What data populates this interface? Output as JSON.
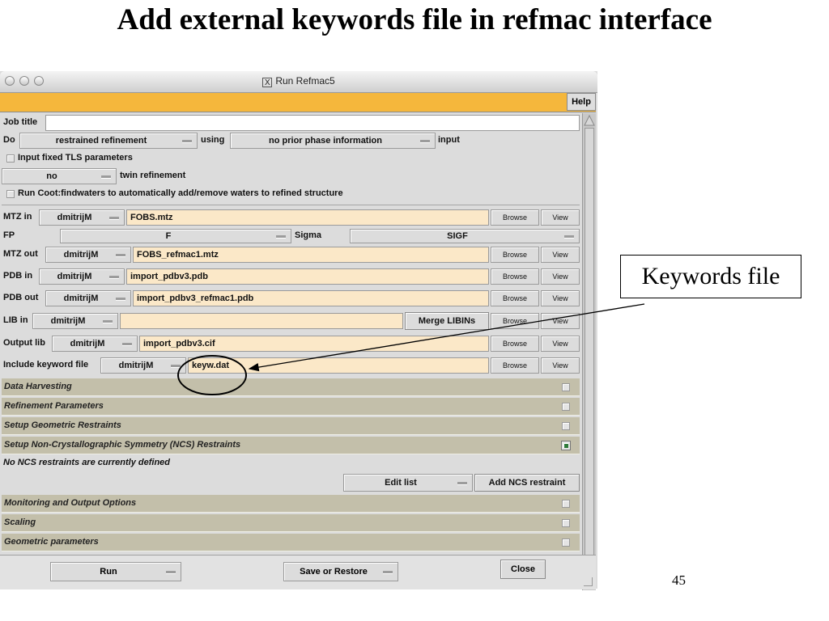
{
  "slide": {
    "title": "Add external keywords file in refmac interface",
    "page_number": "45"
  },
  "window": {
    "title": "Run Refmac5",
    "help_label": "Help"
  },
  "job": {
    "label": "Job title",
    "value": ""
  },
  "do_row": {
    "do_label": "Do",
    "mode": "restrained refinement",
    "using_label": "using",
    "phase": "no prior phase information",
    "input_label": "input"
  },
  "tls": {
    "label": "Input fixed TLS parameters",
    "checked": false
  },
  "twin": {
    "value": "no",
    "label": "twin refinement"
  },
  "coot": {
    "label": "Run Coot:findwaters to automatically add/remove waters to refined structure",
    "checked": false
  },
  "files": {
    "browse_label": "Browse",
    "view_label": "View",
    "mtz_in": {
      "label": "MTZ in",
      "project": "dmitrijM",
      "value": "FOBS.mtz"
    },
    "fp": {
      "label": "FP",
      "value": "F",
      "sigma_label": "Sigma",
      "sigma_value": "SIGF"
    },
    "mtz_out": {
      "label": "MTZ out",
      "project": "dmitrijM",
      "value": "FOBS_refmac1.mtz"
    },
    "pdb_in": {
      "label": "PDB in",
      "project": "dmitrijM",
      "value": "import_pdbv3.pdb"
    },
    "pdb_out": {
      "label": "PDB out",
      "project": "dmitrijM",
      "value": "import_pdbv3_refmac1.pdb"
    },
    "lib_in": {
      "label": "LIB in",
      "project": "dmitrijM",
      "value": "",
      "merge_label": "Merge LIBINs"
    },
    "output_lib": {
      "label": "Output lib",
      "project": "dmitrijM",
      "value": "import_pdbv3.cif"
    },
    "keyword_file": {
      "label": "Include keyword file",
      "project": "dmitrijM",
      "value": "keyw.dat"
    }
  },
  "sections": {
    "data_harvesting": "Data Harvesting",
    "refinement_parameters": "Refinement Parameters",
    "geometric_restraints": "Setup Geometric Restraints",
    "ncs": "Setup Non-Crystallographic Symmetry (NCS) Restraints",
    "ncs_note": "No NCS restraints are currently defined",
    "edit_list_label": "Edit list",
    "add_ncs_label": "Add NCS restraint",
    "monitoring": "Monitoring and Output Options",
    "scaling": "Scaling",
    "geometric_parameters": "Geometric parameters"
  },
  "bottom": {
    "run_label": "Run",
    "save_label": "Save or Restore",
    "close_label": "Close"
  },
  "annotation": {
    "callout_text": "Keywords file"
  },
  "colors": {
    "help_bar": "#f5b73c",
    "field_bg": "#fbe8c8",
    "section_bg": "#c3bfaa",
    "ncs_check": "#2e7a3a"
  }
}
